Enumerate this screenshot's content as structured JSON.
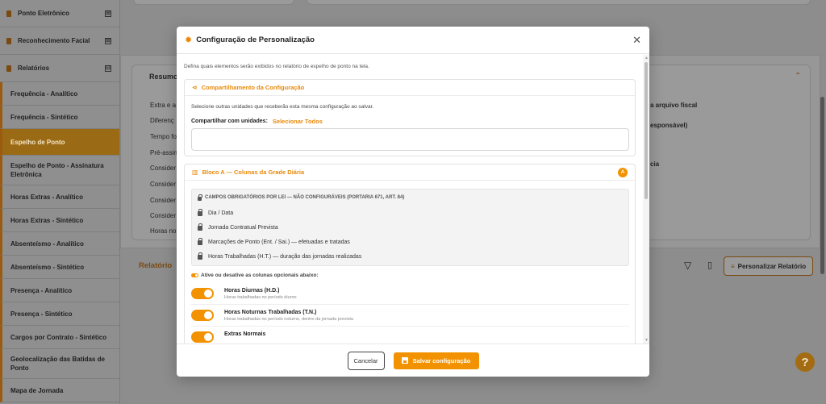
{
  "sidebar": {
    "groups": [
      {
        "label": "Ponto Eletrônico",
        "toggle": "⊞"
      },
      {
        "label": "Reconhecimento Facial",
        "toggle": "⊞"
      },
      {
        "label": "Relatórios",
        "toggle": "⊟"
      }
    ],
    "items": [
      "Frequência - Analítico",
      "Frequência - Sintético",
      "Espelho de Ponto",
      "Espelho de Ponto - Assinatura Eletrônica",
      "Horas Extras - Analítico",
      "Horas Extras - Sintético",
      "Absenteísmo - Analítico",
      "Absenteísmo - Sintético",
      "Presença - Analítico",
      "Presença - Sintético",
      "Cargos por Contrato - Sintético",
      "Geolocalização das Batidas de Ponto",
      "Mapa de Jornada"
    ],
    "active_item": "Espelho de Ponto"
  },
  "background": {
    "summary_title": "Resumo",
    "left_labels": [
      "Extra e a",
      "Diferenç",
      "Tempo fo",
      "Pré-assin",
      "Consider",
      "Consider",
      "Consider",
      "Consider",
      "Horas no"
    ],
    "right_labels": [
      "a arquivo fiscal",
      "esponsável)",
      "cia"
    ],
    "report_title": "Relatório",
    "personalize_button": "Personalizar Relatório",
    "help": "?"
  },
  "modal": {
    "title": "Configuração de Personalização",
    "intro": "Defina quais elementos serão exibidos no relatório de espelho de ponto na tela.",
    "share": {
      "title": "Compartilhamento da Configuração",
      "description": "Selecione outras unidades que receberão esta mesma configuração ao salvar.",
      "share_label": "Compartilhar com unidades:",
      "select_all": "Selecionar Todos",
      "units_value": ""
    },
    "block_a": {
      "title": "Bloco A — Colunas da Grade Diária",
      "badge": "A",
      "mandatory_title": "CAMPOS OBRIGATÓRIOS POR LEI — NÃO CONFIGURÁVEIS (PORTARIA 671, ART. 84)",
      "mandatory_items": [
        "Dia / Data",
        "Jornada Contratual Prevista",
        "Marcações de Ponto (Ent. / Sai.) — efetuadas e tratadas",
        "Horas Trabalhadas (H.T.) — duração das jornadas realizadas"
      ],
      "optional_label": "Ative ou desative as colunas opcionais abaixo:",
      "optional_items": [
        {
          "name": "Horas Diurnas (H.D.)",
          "desc": "Horas trabalhadas no período diurno",
          "enabled": true
        },
        {
          "name": "Horas Noturnas Trabalhadas (T.N.)",
          "desc": "Horas trabalhadas no período noturno, dentro da jornada prevista",
          "enabled": true
        },
        {
          "name": "Extras Normais",
          "desc": "",
          "enabled": true
        }
      ]
    },
    "footer": {
      "cancel": "Cancelar",
      "save": "Salvar configuração"
    }
  },
  "colors": {
    "accent": "#f39200",
    "accent_text": "#e8890b",
    "overlay": "#8d8d8d"
  }
}
